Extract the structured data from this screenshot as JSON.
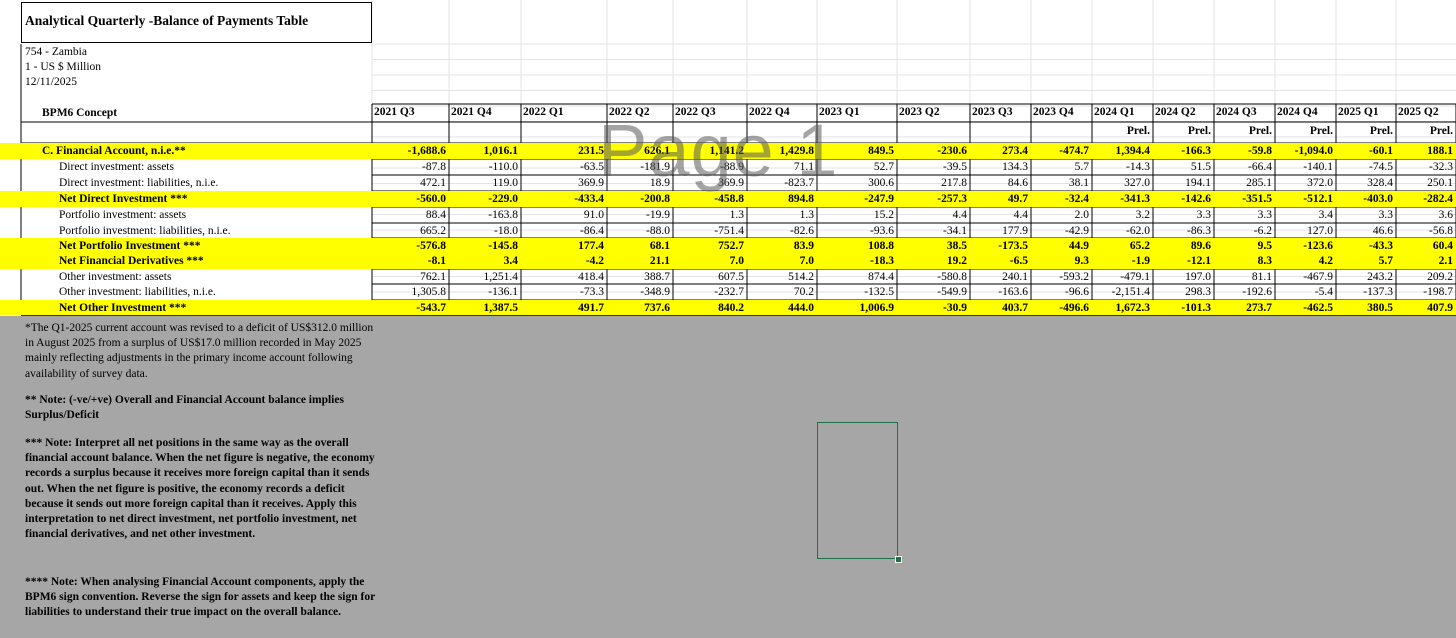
{
  "header": {
    "title": "Analytical Quarterly -Balance of Payments Table",
    "country": "754 - Zambia",
    "unit": "1 - US $ Million",
    "date": "12/11/2025"
  },
  "concept_header": "BPM6 Concept",
  "watermark": "Page 1",
  "columns": [
    "2021 Q3",
    "2021 Q4",
    "2022 Q1",
    "2022 Q2",
    "2022 Q3",
    "2022 Q4",
    "2023 Q1",
    "2023 Q2",
    "2023 Q3",
    "2023 Q4",
    "2024 Q1",
    "2024 Q2",
    "2024 Q3",
    "2024 Q4",
    "2025 Q1",
    "2025 Q2"
  ],
  "prel": [
    "",
    "",
    "",
    "",
    "",
    "",
    "",
    "",
    "",
    "",
    "Prel.",
    "Prel.",
    "Prel.",
    "Prel.",
    "Prel.",
    "Prel."
  ],
  "rows": [
    {
      "label": "C. Financial Account, n.i.e.**",
      "bold": true,
      "highlight": true,
      "indent": false,
      "values": [
        "-1,688.6",
        "1,016.1",
        "231.5",
        "626.1",
        "1,141.2",
        "1,429.8",
        "849.5",
        "-230.6",
        "273.4",
        "-474.7",
        "1,394.4",
        "-166.3",
        "-59.8",
        "-1,094.0",
        "-60.1",
        "188.1"
      ]
    },
    {
      "label": "Direct investment: assets",
      "bold": false,
      "highlight": false,
      "indent": true,
      "values": [
        "-87.8",
        "-110.0",
        "-63.5",
        "-181.9",
        "-88.9",
        "71.1",
        "52.7",
        "-39.5",
        "134.3",
        "5.7",
        "-14.3",
        "51.5",
        "-66.4",
        "-140.1",
        "-74.5",
        "-32.3"
      ]
    },
    {
      "label": "Direct investment: liabilities, n.i.e.",
      "bold": false,
      "highlight": false,
      "indent": true,
      "values": [
        "472.1",
        "119.0",
        "369.9",
        "18.9",
        "369.9",
        "-823.7",
        "300.6",
        "217.8",
        "84.6",
        "38.1",
        "327.0",
        "194.1",
        "285.1",
        "372.0",
        "328.4",
        "250.1"
      ]
    },
    {
      "label": "Net Direct Investment ***",
      "bold": true,
      "highlight": true,
      "indent": true,
      "values": [
        "-560.0",
        "-229.0",
        "-433.4",
        "-200.8",
        "-458.8",
        "894.8",
        "-247.9",
        "-257.3",
        "49.7",
        "-32.4",
        "-341.3",
        "-142.6",
        "-351.5",
        "-512.1",
        "-403.0",
        "-282.4"
      ]
    },
    {
      "label": "Portfolio investment: assets",
      "bold": false,
      "highlight": false,
      "indent": true,
      "values": [
        "88.4",
        "-163.8",
        "91.0",
        "-19.9",
        "1.3",
        "1.3",
        "15.2",
        "4.4",
        "4.4",
        "2.0",
        "3.2",
        "3.3",
        "3.3",
        "3.4",
        "3.3",
        "3.6"
      ]
    },
    {
      "label": "Portfolio investment: liabilities, n.i.e.",
      "bold": false,
      "highlight": false,
      "indent": true,
      "values": [
        "665.2",
        "-18.0",
        "-86.4",
        "-88.0",
        "-751.4",
        "-82.6",
        "-93.6",
        "-34.1",
        "177.9",
        "-42.9",
        "-62.0",
        "-86.3",
        "-6.2",
        "127.0",
        "46.6",
        "-56.8"
      ]
    },
    {
      "label": "Net Portfolio Investment ***",
      "bold": true,
      "highlight": true,
      "indent": true,
      "values": [
        "-576.8",
        "-145.8",
        "177.4",
        "68.1",
        "752.7",
        "83.9",
        "108.8",
        "38.5",
        "-173.5",
        "44.9",
        "65.2",
        "89.6",
        "9.5",
        "-123.6",
        "-43.3",
        "60.4"
      ]
    },
    {
      "label": "Net Financial Derivatives ***",
      "bold": true,
      "highlight": true,
      "indent": true,
      "values": [
        "-8.1",
        "3.4",
        "-4.2",
        "21.1",
        "7.0",
        "7.0",
        "-18.3",
        "19.2",
        "-6.5",
        "9.3",
        "-1.9",
        "-12.1",
        "8.3",
        "4.2",
        "5.7",
        "2.1"
      ]
    },
    {
      "label": "Other investment: assets",
      "bold": false,
      "highlight": false,
      "indent": true,
      "values": [
        "762.1",
        "1,251.4",
        "418.4",
        "388.7",
        "607.5",
        "514.2",
        "874.4",
        "-580.8",
        "240.1",
        "-593.2",
        "-479.1",
        "197.0",
        "81.1",
        "-467.9",
        "243.2",
        "209.2"
      ]
    },
    {
      "label": "Other investment: liabilities, n.i.e.",
      "bold": false,
      "highlight": false,
      "indent": true,
      "values": [
        "1,305.8",
        "-136.1",
        "-73.3",
        "-348.9",
        "-232.7",
        "70.2",
        "-132.5",
        "-549.9",
        "-163.6",
        "-96.6",
        "-2,151.4",
        "298.3",
        "-192.6",
        "-5.4",
        "-137.3",
        "-198.7"
      ]
    },
    {
      "label": "Net Other Investment ***",
      "bold": true,
      "highlight": true,
      "indent": true,
      "values": [
        "-543.7",
        "1,387.5",
        "491.7",
        "737.6",
        "840.2",
        "444.0",
        "1,006.9",
        "-30.9",
        "403.7",
        "-496.6",
        "1,672.3",
        "-101.3",
        "273.7",
        "-462.5",
        "380.5",
        "407.9"
      ]
    }
  ],
  "notes": {
    "n1": "*The Q1-2025 current account was revised to a deficit of US$312.0 million in August 2025 from a surplus of US$17.0 million recorded in May 2025 mainly reflecting adjustments in the primary income account following availability of survey data.",
    "n2": "** Note: (-ve/+ve) Overall and Financial Account balance implies Surplus/Deficit",
    "n3": "*** Note: Interpret all net positions in the same way as the overall financial account balance. When the net figure is negative, the economy records a surplus because it receives more foreign capital than it sends out. When the net figure is positive, the economy records a deficit because it sends out more foreign capital than it receives. Apply this interpretation to net direct investment, net portfolio investment, net financial derivatives, and net other investment.",
    "n4": "**** Note: When analysing Financial Account components, apply the BPM6 sign convention. Reverse the sign for assets and keep the sign for liabilities to understand their true impact on the overall balance."
  }
}
